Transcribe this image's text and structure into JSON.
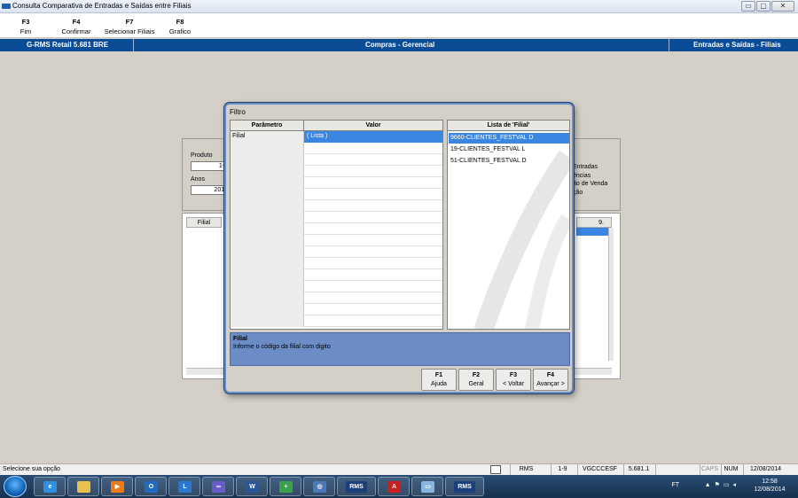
{
  "window": {
    "title": "Consulta Comparativa de Entradas e Saídas entre Filiais",
    "controls": [
      "▭",
      "▢",
      "✕"
    ]
  },
  "fkeys": [
    {
      "key": "F3",
      "label": "Fim"
    },
    {
      "key": "F4",
      "label": "Confirmar"
    },
    {
      "key": "F7",
      "label": "Selecionar Filiais"
    },
    {
      "key": "F8",
      "label": "Grafico"
    }
  ],
  "bluebar": {
    "left": "G-RMS Retail 5.681 BRE",
    "center": "Compras - Gerencial",
    "right": "Entradas e Saídas - Filiais"
  },
  "background": {
    "produto_label": "Produto",
    "produto_value": "1-9",
    "anos_label": "Anos",
    "anos_value": "2012",
    "options": [
      "Entradas",
      "ências",
      "ão de Venda",
      "ção"
    ],
    "grid_header_filial": "Filial",
    "grid_header_right": "9."
  },
  "dialog": {
    "title": "Filtro",
    "col_param": "Parâmetro",
    "col_valor": "Valor",
    "rows": [
      {
        "param": "Filial",
        "valor": "( Lista )"
      }
    ],
    "list_title": "Lista de 'Filial'",
    "list_items": [
      "9660-CLIENTES_FESTVAL D",
      "19-CLIENTES_FESTVAL L",
      "51-CLIENTES_FESTVAL D"
    ],
    "help_title": "Filial",
    "help_text": "Informe o código da filial com digito",
    "buttons": [
      {
        "key": "F1",
        "label": "Ajuda"
      },
      {
        "key": "F2",
        "label": "Geral"
      },
      {
        "key": "F3",
        "label": "< Voltar"
      },
      {
        "key": "F4",
        "label": "Avançar >"
      }
    ]
  },
  "statusbar": {
    "message": "Selecione sua opção",
    "cells": [
      "RMS",
      "1-9",
      "VGCCCESF",
      "5.681.1",
      "",
      "CAPS",
      "NUM",
      "12/08/2014"
    ]
  },
  "taskbar": {
    "lang": "FT",
    "time": "12:58",
    "date": "12/08/2014",
    "icons": [
      "ie-icon",
      "explorer-icon",
      "media-player-icon",
      "outlook-icon",
      "lync-icon",
      "meeting-icon",
      "word-icon",
      "calculator-icon",
      "app-icon",
      "rms-app-icon",
      "acrobat-icon",
      "window-icon",
      "rms-app-icon-2"
    ]
  },
  "colors": {
    "accent": "#0a4c96",
    "dialog_border": "#6c8fc2",
    "help_bg": "#6b8cc4",
    "selected": "#3a86e0"
  }
}
